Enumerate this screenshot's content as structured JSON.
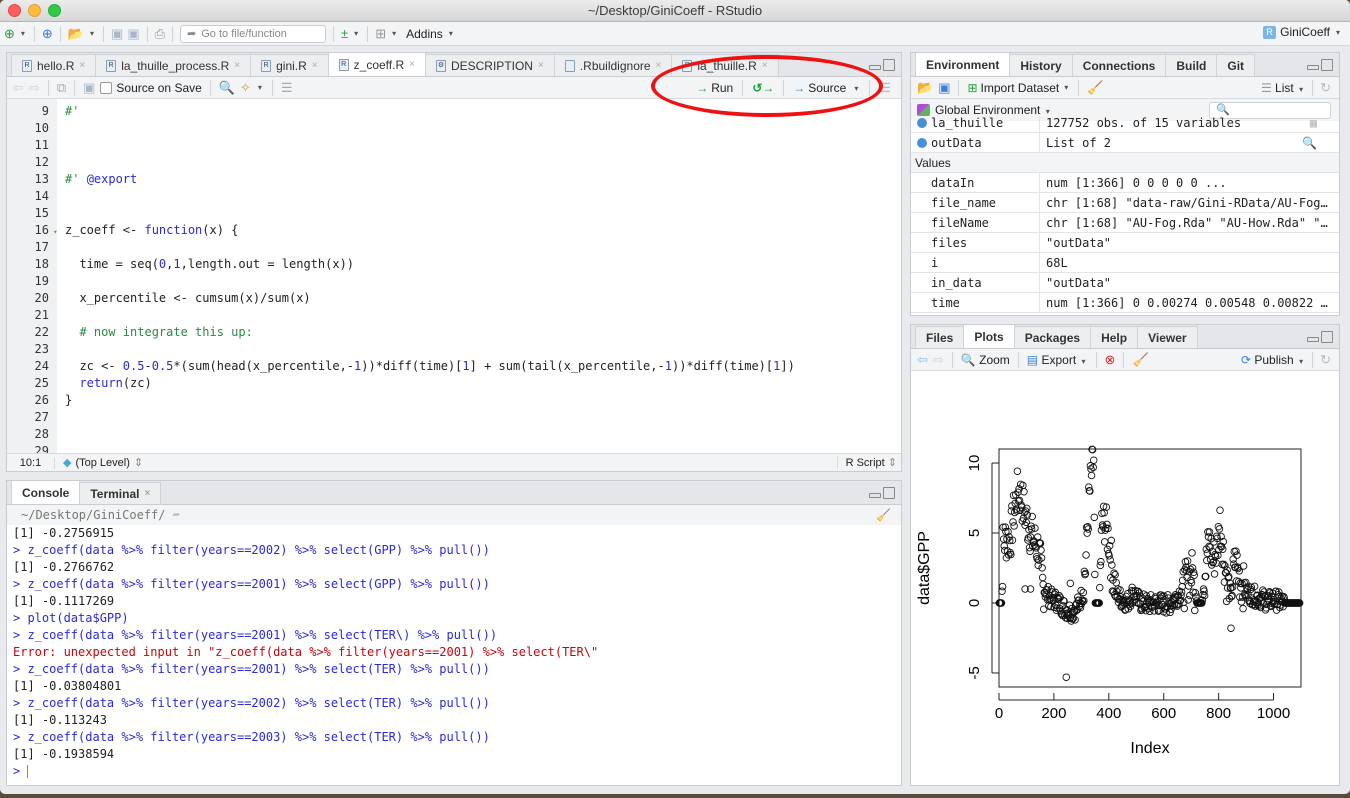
{
  "window": {
    "title": "~/Desktop/GiniCoeff - RStudio"
  },
  "main_toolbar": {
    "goto_placeholder": "Go to file/function",
    "addins_label": "Addins",
    "project_label": "GiniCoeff"
  },
  "editor": {
    "tabs": [
      {
        "label": "hello.R",
        "active": false
      },
      {
        "label": "la_thuille_process.R",
        "active": false
      },
      {
        "label": "gini.R",
        "active": false
      },
      {
        "label": "z_coeff.R",
        "active": true
      },
      {
        "label": "DESCRIPTION",
        "active": false
      },
      {
        "label": ".Rbuildignore",
        "active": false
      },
      {
        "label": "la_thuille.R",
        "active": false
      }
    ],
    "source_on_save_label": "Source on Save",
    "run_label": "Run",
    "source_label": "Source",
    "lines": [
      {
        "n": "9",
        "html": "<span class=\"cm\">#'</span>"
      },
      {
        "n": "10",
        "html": ""
      },
      {
        "n": "11",
        "html": ""
      },
      {
        "n": "12",
        "html": ""
      },
      {
        "n": "13",
        "html": "<span class=\"cm\">#'</span> <span class=\"rx\">@export</span>"
      },
      {
        "n": "14",
        "html": ""
      },
      {
        "n": "15",
        "html": ""
      },
      {
        "n": "16",
        "html": "z_coeff &lt;- <span class=\"kw\">function</span>(x) {",
        "fold": true
      },
      {
        "n": "17",
        "html": ""
      },
      {
        "n": "18",
        "html": "  time = seq(<span class=\"num\">0</span>,<span class=\"num\">1</span>,length.out = length(x))"
      },
      {
        "n": "19",
        "html": ""
      },
      {
        "n": "20",
        "html": "  x_percentile &lt;- cumsum(x)/sum(x)"
      },
      {
        "n": "21",
        "html": ""
      },
      {
        "n": "22",
        "html": "  <span class=\"cm\"># now integrate this up:</span>"
      },
      {
        "n": "23",
        "html": ""
      },
      {
        "n": "24",
        "html": "  zc &lt;- <span class=\"num\">0.5</span>-<span class=\"num\">0.5</span>*(sum(head(x_percentile,-<span class=\"num\">1</span>))*diff(time)[<span class=\"num\">1</span>] + sum(tail(x_percentile,-<span class=\"num\">1</span>))*diff(time)[<span class=\"num\">1</span>])"
      },
      {
        "n": "25",
        "html": "  <span class=\"kw\">return</span>(zc)"
      },
      {
        "n": "26",
        "html": "}"
      },
      {
        "n": "27",
        "html": ""
      },
      {
        "n": "28",
        "html": ""
      },
      {
        "n": "29",
        "html": ""
      }
    ],
    "status": {
      "position": "10:1",
      "scope": "(Top Level)",
      "filetype": "R Script"
    }
  },
  "console": {
    "tabs": [
      {
        "label": "Console",
        "active": true
      },
      {
        "label": "Terminal",
        "active": false
      }
    ],
    "path": "~/Desktop/GiniCoeff/",
    "lines": [
      {
        "type": "out",
        "text": "[1] -0.2756915"
      },
      {
        "type": "cmd",
        "text": "> z_coeff(data %>% filter(years==2002) %>% select(GPP) %>% pull())"
      },
      {
        "type": "out",
        "text": "[1] -0.2766762"
      },
      {
        "type": "cmd",
        "text": "> z_coeff(data %>% filter(years==2001) %>% select(GPP) %>% pull())"
      },
      {
        "type": "out",
        "text": "[1] -0.1117269"
      },
      {
        "type": "cmd",
        "text": "> plot(data$GPP)"
      },
      {
        "type": "cmd",
        "text": "> z_coeff(data %>% filter(years==2001) %>% select(TER\\) %>% pull())"
      },
      {
        "type": "err",
        "text": "Error: unexpected input in \"z_coeff(data %>% filter(years==2001) %>% select(TER\\\""
      },
      {
        "type": "cmd",
        "text": "> z_coeff(data %>% filter(years==2001) %>% select(TER) %>% pull())"
      },
      {
        "type": "out",
        "text": "[1] -0.03804801"
      },
      {
        "type": "cmd",
        "text": "> z_coeff(data %>% filter(years==2002) %>% select(TER) %>% pull())"
      },
      {
        "type": "out",
        "text": "[1] -0.113243"
      },
      {
        "type": "cmd",
        "text": "> z_coeff(data %>% filter(years==2003) %>% select(TER) %>% pull())"
      },
      {
        "type": "out",
        "text": "[1] -0.1938594"
      },
      {
        "type": "cmd",
        "text": "> "
      }
    ]
  },
  "environment": {
    "tabs": [
      {
        "label": "Environment",
        "active": true
      },
      {
        "label": "History",
        "active": false
      },
      {
        "label": "Connections",
        "active": false
      },
      {
        "label": "Build",
        "active": false
      },
      {
        "label": "Git",
        "active": false
      }
    ],
    "import_label": "Import Dataset",
    "view_label": "List",
    "scope_label": "Global Environment",
    "data_rows": [
      {
        "name": "la_thuille",
        "value": "127752 obs. of 15 variables"
      },
      {
        "name": "outData",
        "value": "List of 2"
      }
    ],
    "values_header": "Values",
    "value_rows": [
      {
        "name": "dataIn",
        "value": "num [1:366] 0 0 0 0 0 ..."
      },
      {
        "name": "file_name",
        "value": "chr [1:68] \"data-raw/Gini-RData/AU-Fog…"
      },
      {
        "name": "fileName",
        "value": "chr [1:68] \"AU-Fog.Rda\" \"AU-How.Rda\" \"…"
      },
      {
        "name": "files",
        "value": "\"outData\""
      },
      {
        "name": "i",
        "value": "68L"
      },
      {
        "name": "in_data",
        "value": "\"outData\""
      },
      {
        "name": "time",
        "value": "num [1:366] 0 0.00274 0.00548 0.00822 …"
      }
    ]
  },
  "plots_pane": {
    "tabs": [
      {
        "label": "Files",
        "active": false
      },
      {
        "label": "Plots",
        "active": true
      },
      {
        "label": "Packages",
        "active": false
      },
      {
        "label": "Help",
        "active": false
      },
      {
        "label": "Viewer",
        "active": false
      }
    ],
    "zoom_label": "Zoom",
    "export_label": "Export",
    "publish_label": "Publish"
  },
  "chart_data": {
    "type": "scatter",
    "title": "",
    "xlabel": "Index",
    "ylabel": "data$GPP",
    "xlim": [
      0,
      1100
    ],
    "ylim": [
      -6,
      11
    ],
    "xticks": [
      0,
      200,
      400,
      600,
      800,
      1000
    ],
    "yticks": [
      -5,
      0,
      5,
      10
    ],
    "grid": false,
    "marker": "open-circle",
    "trend": [
      [
        0,
        0
      ],
      [
        10,
        0
      ],
      [
        15,
        4.2
      ],
      [
        25,
        4.6
      ],
      [
        40,
        4.5
      ],
      [
        55,
        6.5
      ],
      [
        70,
        8.2
      ],
      [
        85,
        7.2
      ],
      [
        100,
        6.0
      ],
      [
        115,
        5.0
      ],
      [
        130,
        4.3
      ],
      [
        145,
        3.8
      ],
      [
        160,
        1.2
      ],
      [
        175,
        0.6
      ],
      [
        190,
        0.3
      ],
      [
        205,
        0.2
      ],
      [
        220,
        0
      ],
      [
        240,
        -0.4
      ],
      [
        260,
        -0.6
      ],
      [
        280,
        -0.5
      ],
      [
        300,
        0.4
      ],
      [
        315,
        2.5
      ],
      [
        325,
        6.5
      ],
      [
        335,
        9.0
      ],
      [
        345,
        10.2
      ],
      [
        350,
        0
      ],
      [
        365,
        0
      ],
      [
        375,
        5.5
      ],
      [
        385,
        5.8
      ],
      [
        400,
        4.5
      ],
      [
        415,
        2.0
      ],
      [
        430,
        0.6
      ],
      [
        450,
        0.2
      ],
      [
        470,
        0.1
      ],
      [
        490,
        0.8
      ],
      [
        510,
        0.1
      ],
      [
        540,
        -0.1
      ],
      [
        580,
        0
      ],
      [
        620,
        -0.1
      ],
      [
        650,
        0.5
      ],
      [
        670,
        1.0
      ],
      [
        690,
        1.8
      ],
      [
        705,
        2.2
      ],
      [
        720,
        0
      ],
      [
        740,
        0
      ],
      [
        750,
        2.0
      ],
      [
        765,
        4.5
      ],
      [
        780,
        3.0
      ],
      [
        795,
        4.0
      ],
      [
        805,
        5.8
      ],
      [
        815,
        4.0
      ],
      [
        830,
        1.5
      ],
      [
        845,
        0.5
      ],
      [
        860,
        3.0
      ],
      [
        880,
        1.5
      ],
      [
        900,
        0.8
      ],
      [
        920,
        0.6
      ],
      [
        940,
        0.4
      ],
      [
        960,
        0.3
      ],
      [
        980,
        0.1
      ],
      [
        1000,
        0.3
      ],
      [
        1020,
        0.1
      ],
      [
        1040,
        0
      ],
      [
        1100,
        0
      ]
    ],
    "outliers": [
      [
        245,
        -5.3
      ],
      [
        845,
        -1.8
      ],
      [
        260,
        1.4
      ],
      [
        115,
        1.0
      ],
      [
        95,
        1.0
      ]
    ]
  }
}
